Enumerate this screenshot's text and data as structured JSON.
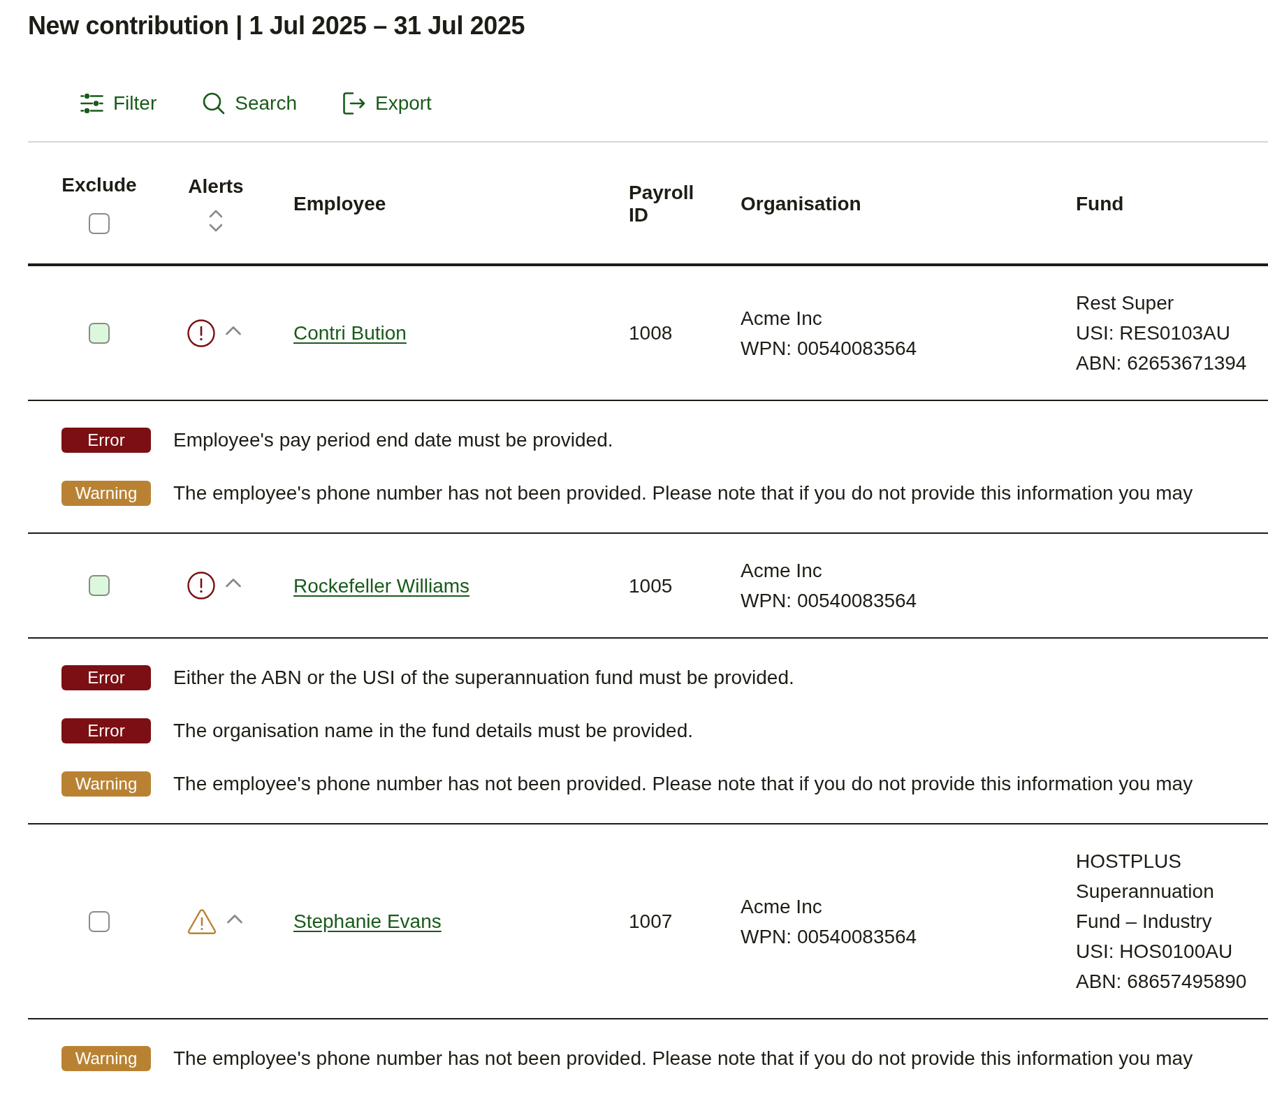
{
  "title": "New contribution | 1 Jul 2025 – 31 Jul 2025",
  "toolbar": [
    {
      "kind": "filter",
      "label": "Filter"
    },
    {
      "kind": "search",
      "label": "Search"
    },
    {
      "kind": "export",
      "label": "Export"
    }
  ],
  "table": {
    "columns": [
      {
        "kind": "exclude",
        "label": "Exclude",
        "checked": false
      },
      {
        "kind": "alerts",
        "label": "Alerts"
      },
      {
        "kind": "text",
        "label": "Employee"
      },
      {
        "kind": "text",
        "label": "Payroll ID"
      },
      {
        "kind": "text",
        "label": "Organisation"
      },
      {
        "kind": "text",
        "label": "Fund"
      }
    ],
    "rows": [
      {
        "kind": "error",
        "excluded": false,
        "highlighted": true,
        "expanded": true,
        "employee": "Contri Bution",
        "payroll_id": "1008",
        "organisation": [
          "Acme Inc",
          "WPN: 00540083564"
        ],
        "fund": [
          "Rest Super",
          "USI: RES0103AU",
          "ABN: 62653671394"
        ],
        "alerts": [
          {
            "kind": "error",
            "label": "Error",
            "message": "Employee's pay period end date must be provided."
          },
          {
            "kind": "warning",
            "label": "Warning",
            "message": "The employee's phone number has not been provided. Please note that if you do not provide this information you may"
          }
        ]
      },
      {
        "kind": "error",
        "excluded": false,
        "highlighted": true,
        "expanded": true,
        "employee": "Rockefeller Williams",
        "payroll_id": "1005",
        "organisation": [
          "Acme Inc",
          "WPN: 00540083564"
        ],
        "alerts": [
          {
            "kind": "error",
            "label": "Error",
            "message": "Either the ABN or the USI of the superannuation fund must be provided."
          },
          {
            "kind": "error",
            "label": "Error",
            "message": "The organisation name in the fund details must be provided."
          },
          {
            "kind": "warning",
            "label": "Warning",
            "message": "The employee's phone number has not been provided. Please note that if you do not provide this information you may"
          }
        ]
      },
      {
        "kind": "warning",
        "excluded": false,
        "highlighted": false,
        "expanded": true,
        "employee": "Stephanie Evans",
        "payroll_id": "1007",
        "organisation": [
          "Acme Inc",
          "WPN: 00540083564"
        ],
        "fund": [
          "HOSTPLUS Superannuation Fund – Industry",
          "USI: HOS0100AU",
          "ABN: 68657495890"
        ],
        "alerts": [
          {
            "kind": "warning",
            "label": "Warning",
            "message": "The employee's phone number has not been provided. Please note that if you do not provide this information you may"
          }
        ]
      }
    ]
  }
}
